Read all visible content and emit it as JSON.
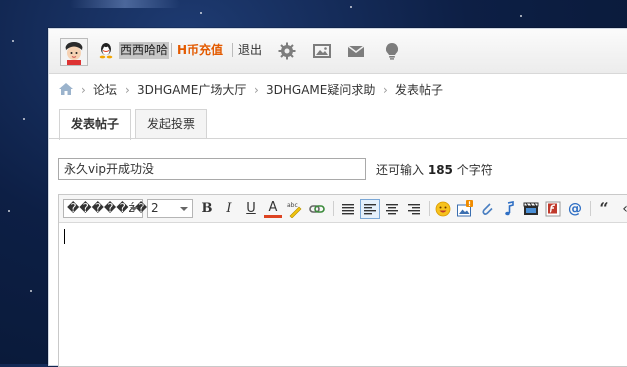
{
  "header": {
    "username": "西西哈哈",
    "hcoin": "H币充值",
    "logout": "退出"
  },
  "icons": {
    "qq": "qq-penguin-icon",
    "settings": "gear-icon",
    "album": "picture-icon",
    "message": "envelope-icon",
    "hint": "lightbulb-icon"
  },
  "breadcrumb": [
    "论坛",
    "3DHGAME广场大厅",
    "3DHGAME疑问求助",
    "发表帖子"
  ],
  "tabs": [
    {
      "label": "发表帖子",
      "active": true
    },
    {
      "label": "发起投票",
      "active": false
    }
  ],
  "subject": {
    "value": "永久vip开成功没",
    "remain_prefix": "还可输入",
    "remain_count": "185",
    "remain_suffix": "个字符"
  },
  "toolbar": {
    "font_value": "�����ź�",
    "size_value": "2",
    "bold": "B",
    "italic": "I",
    "underline": "U",
    "forecolor": "A",
    "quote": "“"
  },
  "colors": {
    "accent": "#e35a00",
    "panel_border": "#cfd7e3",
    "background": "#0d1f45"
  }
}
